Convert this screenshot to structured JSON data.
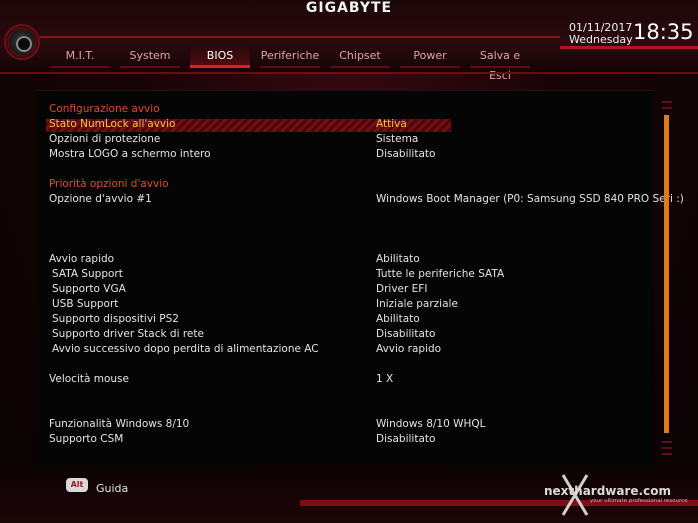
{
  "header": {
    "brand": "GIGABYTE",
    "date": "01/11/2017",
    "weekday": "Wednesday",
    "time": "18:35"
  },
  "tabs": [
    {
      "label": "M.I.T.",
      "active": false
    },
    {
      "label": "System",
      "active": false
    },
    {
      "label": "BIOS",
      "active": true
    },
    {
      "label": "Periferiche",
      "active": false
    },
    {
      "label": "Chipset",
      "active": false
    },
    {
      "label": "Power",
      "active": false
    },
    {
      "label": "Salva e Esci",
      "active": false
    }
  ],
  "settings": {
    "section_boot": "Configurazione avvio",
    "numlock": {
      "label": "Stato NumLock all'avvio",
      "value": "Attiva"
    },
    "protection": {
      "label": "Opzioni di protezione",
      "value": "Sistema"
    },
    "logo": {
      "label": "Mostra LOGO a schermo intero",
      "value": "Disabilitato"
    },
    "section_priority": "Priorità opzioni d'avvio",
    "boot1": {
      "label": "Opzione d'avvio #1",
      "value": "Windows Boot Manager (P0: Samsung SSD 840 PRO Seri :)"
    },
    "fastboot": {
      "label": "Avvio rapido",
      "value": "Abilitato"
    },
    "sata": {
      "label": "SATA Support",
      "value": "Tutte le periferiche SATA"
    },
    "vga": {
      "label": "Supporto VGA",
      "value": "Driver EFI"
    },
    "usb": {
      "label": "USB Support",
      "value": "Iniziale parziale"
    },
    "ps2": {
      "label": "Supporto dispositivi PS2",
      "value": "Abilitato"
    },
    "netstack": {
      "label": "Supporto driver Stack di rete",
      "value": "Disabilitato"
    },
    "ac": {
      "label": "Avvio successivo dopo perdita di alimentazione AC",
      "value": "Avvio rapido"
    },
    "mouse": {
      "label": "Velocità mouse",
      "value": "1 X"
    },
    "win": {
      "label": "Funzionalità Windows 8/10",
      "value": "Windows 8/10 WHQL"
    },
    "csm": {
      "label": "Supporto CSM",
      "value": "Disabilitato"
    }
  },
  "footer": {
    "alt_key": "Alt",
    "help": "Guida",
    "watermark": "nexthardware.com",
    "watermark_tagline": "your ultimate professional resource"
  },
  "colors": {
    "accent": "#e61a24",
    "section": "#e24a2c",
    "highlight_text": "#f5c842",
    "scroll_thumb": "#e07a1f"
  }
}
